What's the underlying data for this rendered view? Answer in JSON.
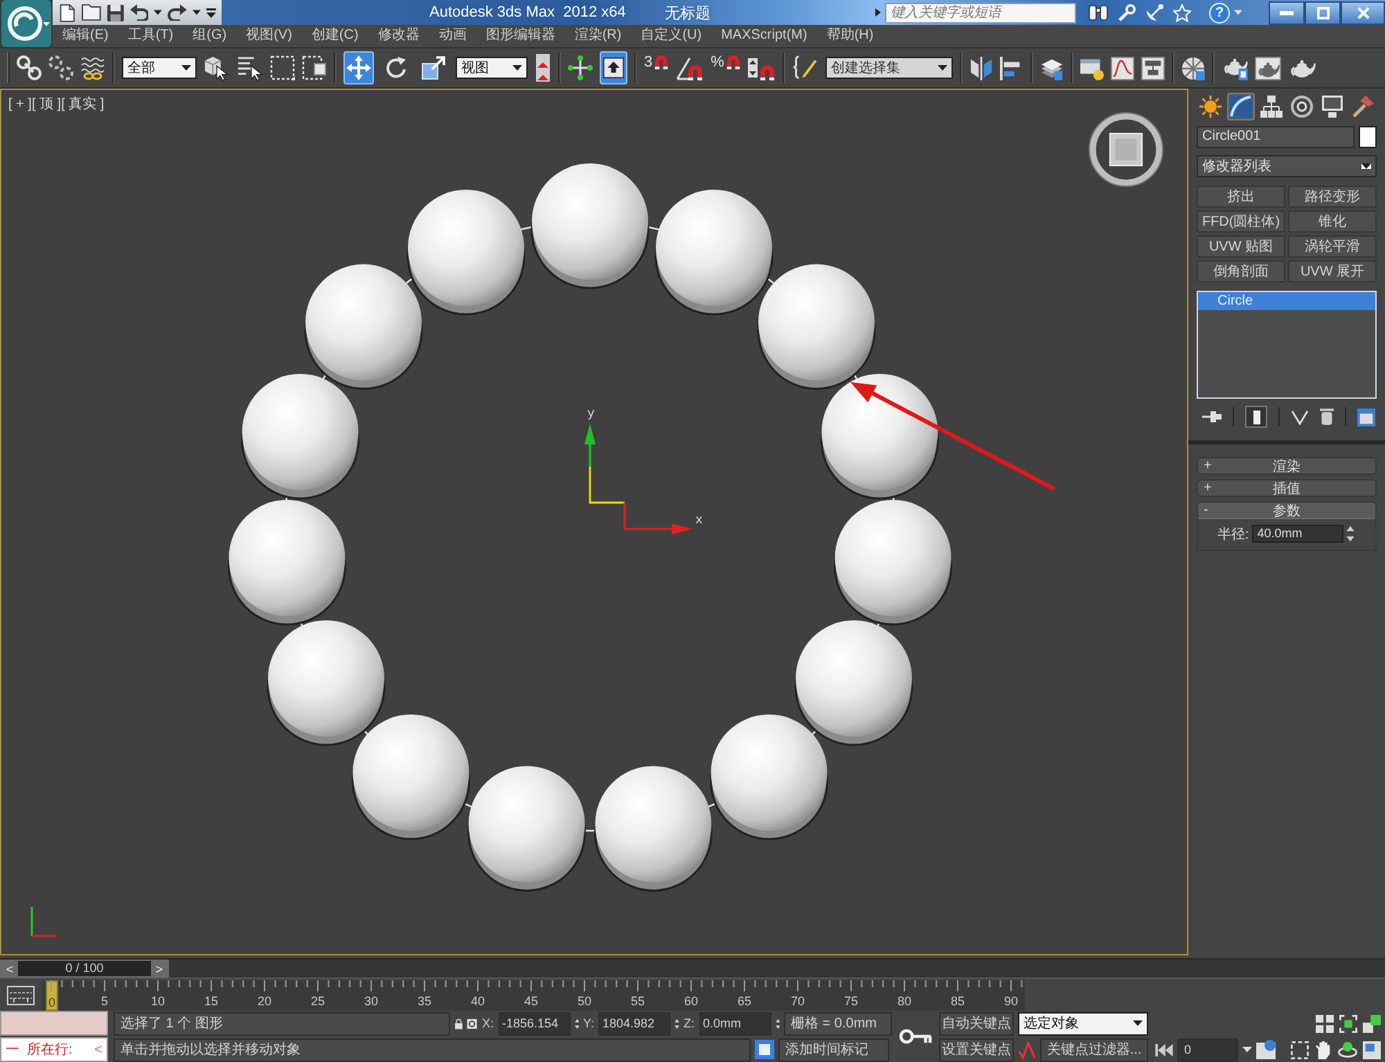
{
  "title_bar": {
    "title": "Autodesk 3ds Max  2012 x64",
    "document": "无标题",
    "search": {
      "placeholder": "键入关键字或短语"
    },
    "help": "?"
  },
  "menu": [
    "编辑(E)",
    "工具(T)",
    "组(G)",
    "视图(V)",
    "创建(C)",
    "修改器",
    "动画",
    "图形编辑器",
    "渲染(R)",
    "自定义(U)",
    "MAXScript(M)",
    "帮助(H)"
  ],
  "toolbar": {
    "selection_filter": "全部",
    "transform_tools": [
      {
        "selected": true
      },
      {
        "selected": false
      },
      {
        "selected": false
      }
    ],
    "reference_coordinate": "视图",
    "keyboard_override": {
      "on": true
    },
    "snap_label": "3",
    "percent_snap_label": "%",
    "named_selection": {
      "placeholder": "创建选择集"
    }
  },
  "viewport": {
    "label": "[ + ][ 顶 ][ 真实 ]",
    "gizmo": {
      "y_label": "y",
      "x_label": "x"
    }
  },
  "command_panel": {
    "tabs": [
      {
        "selected": false
      },
      {
        "selected": true
      },
      {
        "selected": false
      },
      {
        "selected": false
      },
      {
        "selected": false
      },
      {
        "selected": false
      }
    ],
    "object_name": "Circle001",
    "modifier_list": "修改器列表",
    "modifier_buttons": [
      "挤出",
      "路径变形",
      "FFD(圆柱体)",
      "锥化",
      "UVW 贴图",
      "涡轮平滑",
      "倒角剖面",
      "UVW 展开"
    ],
    "stack": [
      {
        "label": "Circle",
        "selected": true
      }
    ],
    "show_end_result": {
      "on": true
    },
    "rollouts": [
      {
        "sign": "+",
        "label": "渲染",
        "expanded": false
      },
      {
        "sign": "+",
        "label": "插值",
        "expanded": false
      },
      {
        "sign": "-",
        "label": "参数",
        "expanded": true,
        "fields": [
          {
            "label": "半径:",
            "value": "40.0mm"
          }
        ]
      }
    ]
  },
  "time_slider": {
    "prev": "<",
    "position": "0 / 100",
    "next": ">",
    "level": 0
  },
  "track_bar": {
    "current": "0",
    "labels": [
      "5",
      "10",
      "15",
      "20",
      "25",
      "30",
      "35",
      "40",
      "45",
      "50",
      "55",
      "60",
      "65",
      "70",
      "75",
      "80",
      "85",
      "90"
    ]
  },
  "status_bar": {
    "listener": {
      "text": "一  所在行:",
      "arrow": "<"
    },
    "message": "选择了 1 个 图形",
    "coordinates": [
      {
        "axis": "X:",
        "value": "-1856.154"
      },
      {
        "axis": "Y:",
        "value": "1804.982"
      },
      {
        "axis": "Z:",
        "value": "0.0mm"
      }
    ],
    "grid": "栅格 = 0.0mm",
    "prompt": "单击并拖动以选择并移动对象",
    "time_tag": "添加时间标记"
  },
  "animation": {
    "auto_key": "自动关键点",
    "key_mode": "选定对象",
    "set_key": "设置关键点",
    "key_filters": "关键点过滤器...",
    "frame": "0"
  }
}
